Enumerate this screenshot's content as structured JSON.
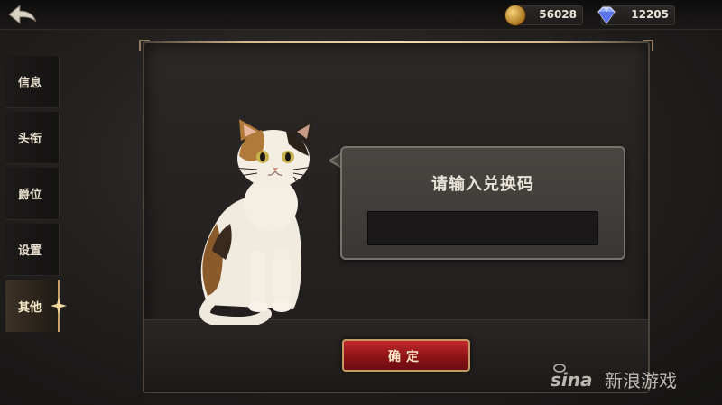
{
  "topbar": {
    "back_icon": "back-arrow-icon",
    "gold": {
      "icon": "gold-coin-icon",
      "value": "56028"
    },
    "diamond": {
      "icon": "diamond-icon",
      "value": "12205"
    }
  },
  "sidebar": {
    "items": [
      {
        "label": "信息",
        "active": false
      },
      {
        "label": "头衔",
        "active": false
      },
      {
        "label": "爵位",
        "active": false
      },
      {
        "label": "设置",
        "active": false
      },
      {
        "label": "其他",
        "active": true
      }
    ]
  },
  "redeem": {
    "title": "请输入兑换码",
    "input_value": "",
    "confirm_label": "确定",
    "mascot_icon": "calico-cat-illustration"
  },
  "watermark": {
    "text": "新浪游戏",
    "logo": "sina-logo"
  },
  "colors": {
    "accent_gold": "#c9a36a",
    "button_red": "#b0212a",
    "panel_bg": "#2b2826"
  }
}
